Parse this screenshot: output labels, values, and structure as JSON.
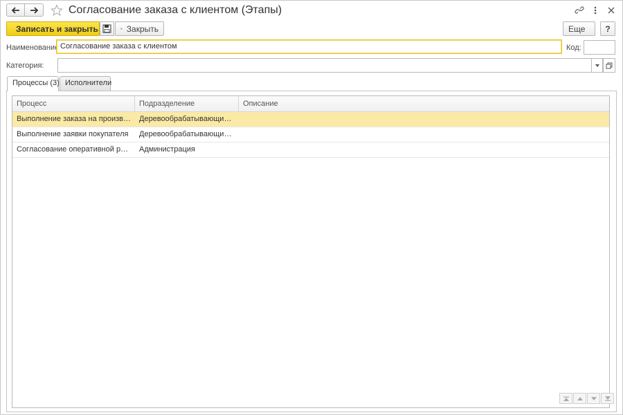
{
  "window": {
    "title": "Согласование заказа с клиентом (Этапы)"
  },
  "toolbar": {
    "save_close_label": "Записать и закрыть",
    "close_label": "Закрыть",
    "more_label": "Еще",
    "help_label": "?"
  },
  "form": {
    "name_label": "Наименование:",
    "name_value": "Согласование заказа с клиентом",
    "code_label": "Код:",
    "code_value": "",
    "category_label": "Категория:",
    "category_value": ""
  },
  "tabs": [
    {
      "label": "Процессы (3)",
      "active": true
    },
    {
      "label": "Исполнители",
      "active": false
    }
  ],
  "grid": {
    "columns": [
      "Процесс",
      "Подразделение",
      "Описание"
    ],
    "rows": [
      {
        "process": "Выполнение заказа на производ...",
        "department": "Деревообрабатывающий цех",
        "description": "",
        "selected": true
      },
      {
        "process": "Выполнение заявки покупателя",
        "department": "Деревообрабатывающий цех",
        "description": "",
        "selected": false
      },
      {
        "process": "Согласование оперативной реал...",
        "department": "Администрация",
        "description": "",
        "selected": false
      }
    ]
  },
  "colors": {
    "accent": "#f1cc16",
    "selected_row": "#fbeaa5"
  }
}
